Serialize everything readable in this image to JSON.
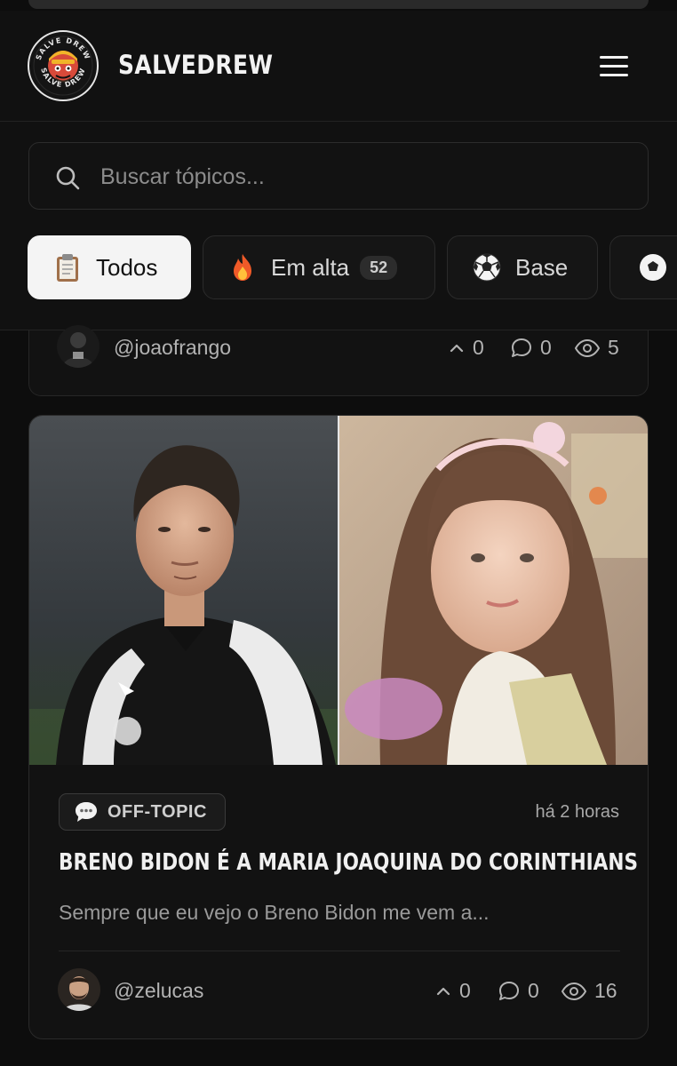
{
  "header": {
    "brand": "SALVEDREW",
    "logo_text": "SALVE DREW"
  },
  "search": {
    "placeholder": "Buscar tópicos..."
  },
  "filters": [
    {
      "label": "Todos",
      "icon": "clipboard-icon",
      "active": true
    },
    {
      "label": "Em alta",
      "icon": "fire-icon",
      "badge": "52"
    },
    {
      "label": "Base",
      "icon": "soccer-ball-icon"
    }
  ],
  "posts": [
    {
      "author": "@joaofrango",
      "upvotes": "0",
      "comments": "0",
      "views": "5"
    },
    {
      "category": "OFF-TOPIC",
      "time": "há 2 horas",
      "title": "BRENO BIDON É A MARIA JOAQUINA DO CORINTHIANS",
      "excerpt": "Sempre que eu vejo o Breno Bidon me vem a...",
      "author": "@zelucas",
      "upvotes": "0",
      "comments": "0",
      "views": "16"
    }
  ],
  "colors": {
    "background": "#0d0d0d",
    "surface": "#121212",
    "active_chip": "#f4f4f4",
    "muted_text": "#9a9a9a"
  }
}
